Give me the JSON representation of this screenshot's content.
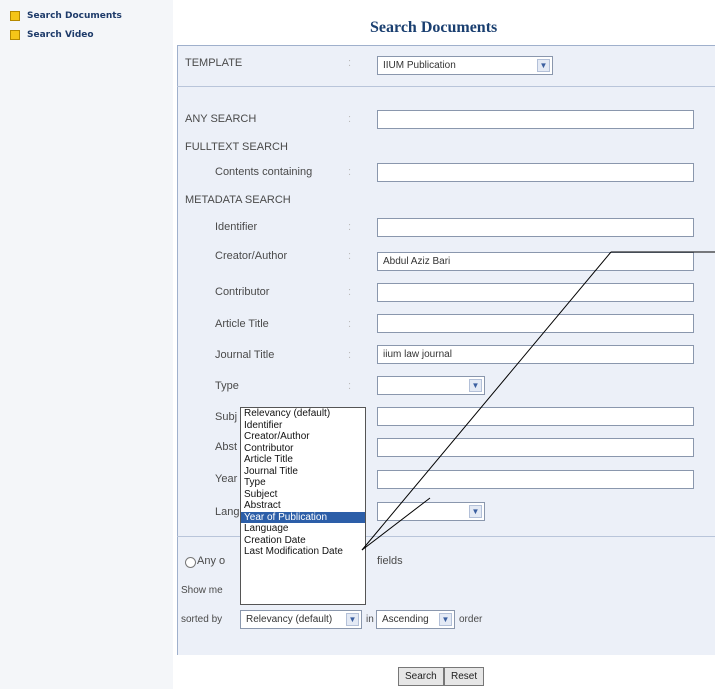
{
  "sidebar": {
    "items": [
      {
        "label": "Search Documents",
        "icon": "folder-icon"
      },
      {
        "label": "Search Video",
        "icon": "folder-icon"
      }
    ]
  },
  "page_title": "Search Documents",
  "form": {
    "template_label": "TEMPLATE",
    "template_value": "IIUM Publication",
    "any_search_label": "ANY SEARCH",
    "any_search_value": "",
    "fulltext_label": "FULLTEXT SEARCH",
    "contents_label": "Contents containing",
    "contents_value": "",
    "metadata_label": "METADATA SEARCH",
    "colon": ":",
    "fields": [
      {
        "label": "Identifier",
        "value": ""
      },
      {
        "label": "Creator/Author",
        "value": "Abdul Aziz Bari"
      },
      {
        "label": "Contributor",
        "value": ""
      },
      {
        "label": "Article Title",
        "value": ""
      },
      {
        "label": "Journal Title",
        "value": "iium law journal"
      },
      {
        "label": "Type",
        "value": ""
      },
      {
        "label": "Subj",
        "value": ""
      },
      {
        "label": "Abst",
        "value": ""
      },
      {
        "label": "Year",
        "value": ""
      },
      {
        "label": "Lang",
        "value": ""
      }
    ],
    "any_of_fields_prefix": "Any o",
    "any_of_fields_suffix": "fields",
    "show_me_label": "Show me",
    "sorted_by_label": "sorted by",
    "sorted_by_value": "Relevancy (default)",
    "in_label": "in",
    "order_value": "Ascending",
    "order_label": "order"
  },
  "sort_options": [
    "Relevancy (default)",
    "Identifier",
    "Creator/Author",
    "Contributor",
    "Article Title",
    "Journal Title",
    "Type",
    "Subject",
    "Abstract",
    "Year of Publication",
    "Language",
    "Creation Date",
    "Last Modification Date"
  ],
  "highlighted_option": "Year of Publication",
  "buttons": {
    "search": "Search",
    "reset": "Reset"
  },
  "colors": {
    "title": "#1a3f70",
    "panel": "#ecf0f8",
    "highlight": "#2c5ea8"
  }
}
